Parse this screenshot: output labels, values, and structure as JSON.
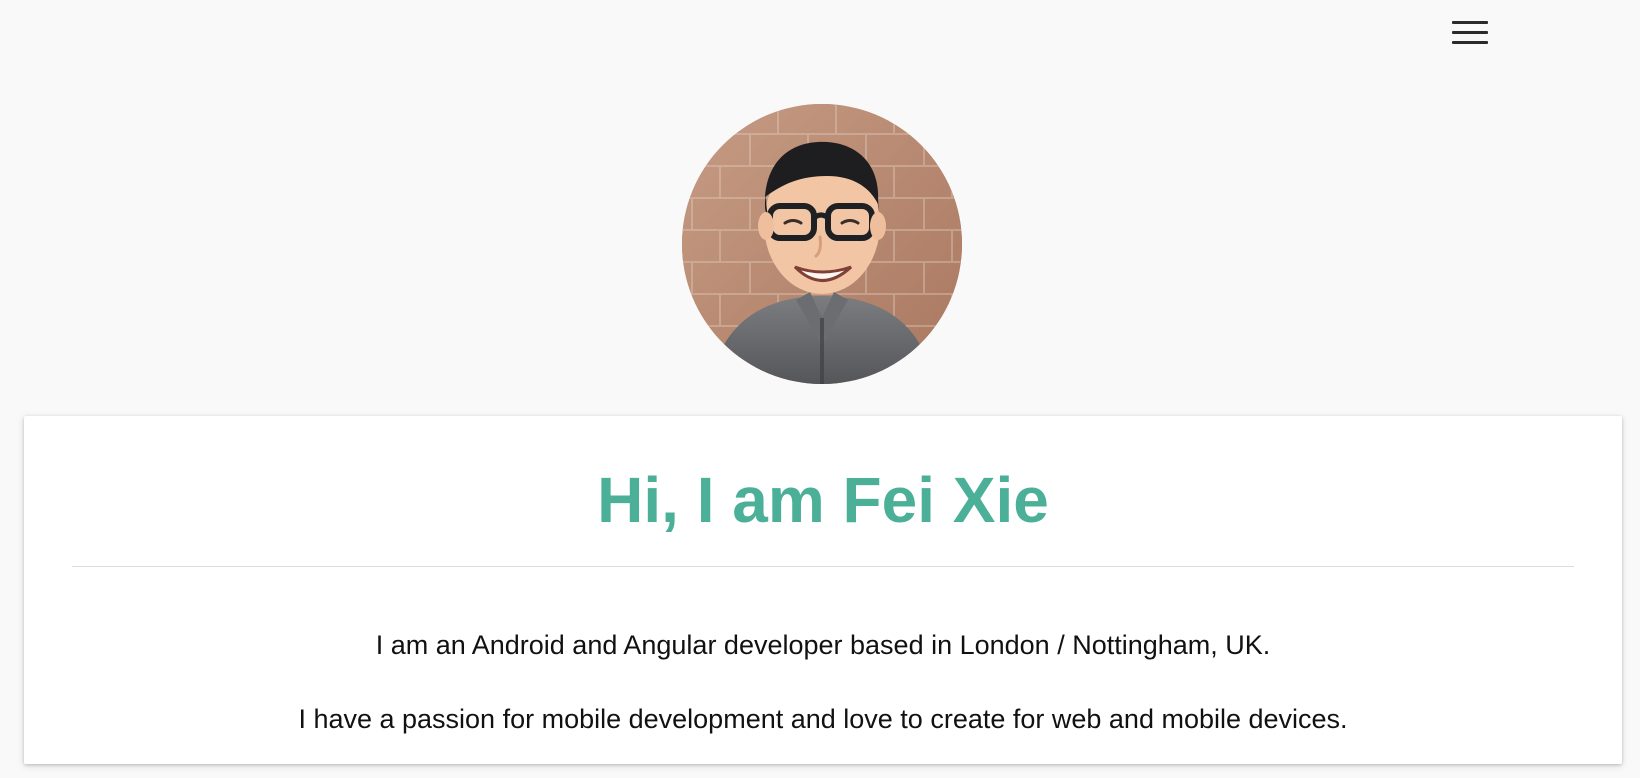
{
  "menu": {
    "icon": "hamburger-menu-icon"
  },
  "profile": {
    "avatar_subject": "avatar",
    "heading": "Hi, I am Fei Xie",
    "paragraphs": [
      "I am an Android and Angular developer based in London / Nottingham, UK.",
      "I have a passion for mobile development and love to create for web and mobile devices."
    ]
  },
  "colors": {
    "background": "#f9f9f9",
    "card": "#ffffff",
    "heading": "#4caf98",
    "text": "#111111",
    "divider": "#dcdcdc",
    "menu_icon": "#2b2b2b"
  }
}
